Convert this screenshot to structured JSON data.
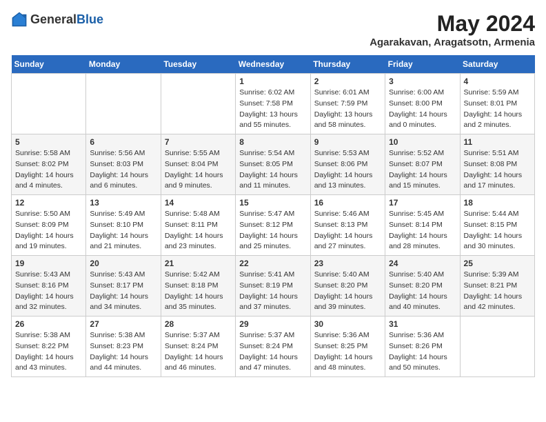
{
  "header": {
    "logo_general": "General",
    "logo_blue": "Blue",
    "month_title": "May 2024",
    "location": "Agarakavan, Aragatsotn, Armenia"
  },
  "weekdays": [
    "Sunday",
    "Monday",
    "Tuesday",
    "Wednesday",
    "Thursday",
    "Friday",
    "Saturday"
  ],
  "weeks": [
    [
      {
        "day": "",
        "info": ""
      },
      {
        "day": "",
        "info": ""
      },
      {
        "day": "",
        "info": ""
      },
      {
        "day": "1",
        "info": "Sunrise: 6:02 AM\nSunset: 7:58 PM\nDaylight: 13 hours and 55 minutes."
      },
      {
        "day": "2",
        "info": "Sunrise: 6:01 AM\nSunset: 7:59 PM\nDaylight: 13 hours and 58 minutes."
      },
      {
        "day": "3",
        "info": "Sunrise: 6:00 AM\nSunset: 8:00 PM\nDaylight: 14 hours and 0 minutes."
      },
      {
        "day": "4",
        "info": "Sunrise: 5:59 AM\nSunset: 8:01 PM\nDaylight: 14 hours and 2 minutes."
      }
    ],
    [
      {
        "day": "5",
        "info": "Sunrise: 5:58 AM\nSunset: 8:02 PM\nDaylight: 14 hours and 4 minutes."
      },
      {
        "day": "6",
        "info": "Sunrise: 5:56 AM\nSunset: 8:03 PM\nDaylight: 14 hours and 6 minutes."
      },
      {
        "day": "7",
        "info": "Sunrise: 5:55 AM\nSunset: 8:04 PM\nDaylight: 14 hours and 9 minutes."
      },
      {
        "day": "8",
        "info": "Sunrise: 5:54 AM\nSunset: 8:05 PM\nDaylight: 14 hours and 11 minutes."
      },
      {
        "day": "9",
        "info": "Sunrise: 5:53 AM\nSunset: 8:06 PM\nDaylight: 14 hours and 13 minutes."
      },
      {
        "day": "10",
        "info": "Sunrise: 5:52 AM\nSunset: 8:07 PM\nDaylight: 14 hours and 15 minutes."
      },
      {
        "day": "11",
        "info": "Sunrise: 5:51 AM\nSunset: 8:08 PM\nDaylight: 14 hours and 17 minutes."
      }
    ],
    [
      {
        "day": "12",
        "info": "Sunrise: 5:50 AM\nSunset: 8:09 PM\nDaylight: 14 hours and 19 minutes."
      },
      {
        "day": "13",
        "info": "Sunrise: 5:49 AM\nSunset: 8:10 PM\nDaylight: 14 hours and 21 minutes."
      },
      {
        "day": "14",
        "info": "Sunrise: 5:48 AM\nSunset: 8:11 PM\nDaylight: 14 hours and 23 minutes."
      },
      {
        "day": "15",
        "info": "Sunrise: 5:47 AM\nSunset: 8:12 PM\nDaylight: 14 hours and 25 minutes."
      },
      {
        "day": "16",
        "info": "Sunrise: 5:46 AM\nSunset: 8:13 PM\nDaylight: 14 hours and 27 minutes."
      },
      {
        "day": "17",
        "info": "Sunrise: 5:45 AM\nSunset: 8:14 PM\nDaylight: 14 hours and 28 minutes."
      },
      {
        "day": "18",
        "info": "Sunrise: 5:44 AM\nSunset: 8:15 PM\nDaylight: 14 hours and 30 minutes."
      }
    ],
    [
      {
        "day": "19",
        "info": "Sunrise: 5:43 AM\nSunset: 8:16 PM\nDaylight: 14 hours and 32 minutes."
      },
      {
        "day": "20",
        "info": "Sunrise: 5:43 AM\nSunset: 8:17 PM\nDaylight: 14 hours and 34 minutes."
      },
      {
        "day": "21",
        "info": "Sunrise: 5:42 AM\nSunset: 8:18 PM\nDaylight: 14 hours and 35 minutes."
      },
      {
        "day": "22",
        "info": "Sunrise: 5:41 AM\nSunset: 8:19 PM\nDaylight: 14 hours and 37 minutes."
      },
      {
        "day": "23",
        "info": "Sunrise: 5:40 AM\nSunset: 8:20 PM\nDaylight: 14 hours and 39 minutes."
      },
      {
        "day": "24",
        "info": "Sunrise: 5:40 AM\nSunset: 8:20 PM\nDaylight: 14 hours and 40 minutes."
      },
      {
        "day": "25",
        "info": "Sunrise: 5:39 AM\nSunset: 8:21 PM\nDaylight: 14 hours and 42 minutes."
      }
    ],
    [
      {
        "day": "26",
        "info": "Sunrise: 5:38 AM\nSunset: 8:22 PM\nDaylight: 14 hours and 43 minutes."
      },
      {
        "day": "27",
        "info": "Sunrise: 5:38 AM\nSunset: 8:23 PM\nDaylight: 14 hours and 44 minutes."
      },
      {
        "day": "28",
        "info": "Sunrise: 5:37 AM\nSunset: 8:24 PM\nDaylight: 14 hours and 46 minutes."
      },
      {
        "day": "29",
        "info": "Sunrise: 5:37 AM\nSunset: 8:24 PM\nDaylight: 14 hours and 47 minutes."
      },
      {
        "day": "30",
        "info": "Sunrise: 5:36 AM\nSunset: 8:25 PM\nDaylight: 14 hours and 48 minutes."
      },
      {
        "day": "31",
        "info": "Sunrise: 5:36 AM\nSunset: 8:26 PM\nDaylight: 14 hours and 50 minutes."
      },
      {
        "day": "",
        "info": ""
      }
    ]
  ]
}
